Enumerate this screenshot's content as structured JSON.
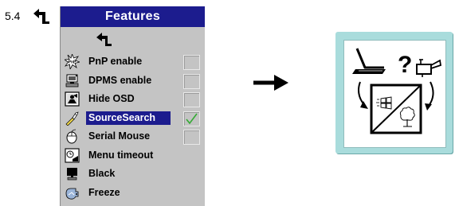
{
  "section": {
    "number": "5.4"
  },
  "osd": {
    "title": "Features",
    "items": [
      {
        "label": "PnP enable",
        "icon": "pnp-icon",
        "checkbox": true,
        "checked": false,
        "selected": false
      },
      {
        "label": "DPMS enable",
        "icon": "dpms-icon",
        "checkbox": true,
        "checked": false,
        "selected": false
      },
      {
        "label": "Hide OSD",
        "icon": "hide-osd-icon",
        "checkbox": true,
        "checked": false,
        "selected": false
      },
      {
        "label": "SourceSearch",
        "icon": "source-search-icon",
        "checkbox": true,
        "checked": true,
        "selected": true
      },
      {
        "label": "Serial Mouse",
        "icon": "mouse-icon",
        "checkbox": true,
        "checked": false,
        "selected": false
      },
      {
        "label": "Menu timeout",
        "icon": "menu-timeout-icon",
        "checkbox": false,
        "checked": false,
        "selected": false
      },
      {
        "label": "Black",
        "icon": "black-screen-icon",
        "checkbox": false,
        "checked": false,
        "selected": false
      },
      {
        "label": "Freeze",
        "icon": "freeze-icon",
        "checkbox": false,
        "checked": false,
        "selected": false
      }
    ]
  },
  "diagram": {
    "question_mark": "?",
    "icons": [
      "laptop-icon",
      "video-camera-icon",
      "projection-screen-icon",
      "windows-icon",
      "tree-icon"
    ]
  },
  "colors": {
    "title_bar": "#1c1c8e",
    "panel": "#c4c4c4",
    "selection": "#1c1c8e",
    "checkmark": "#33aa33",
    "diagram_frame": "#a9dcdc"
  }
}
